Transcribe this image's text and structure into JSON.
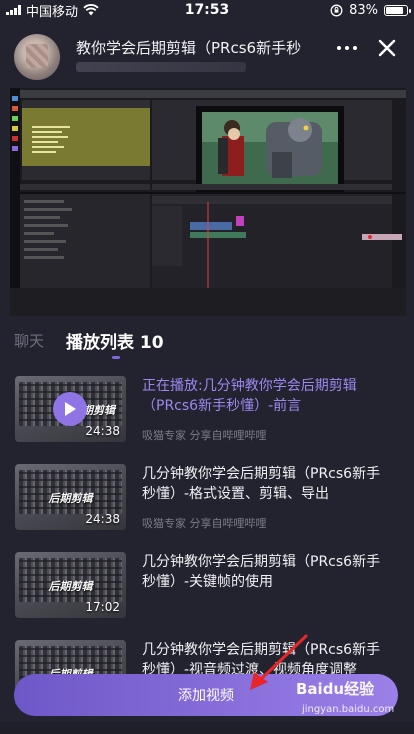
{
  "status_bar": {
    "carrier": "中国移动",
    "time": "17:53",
    "battery": "83%",
    "battery_level": 0.83
  },
  "header": {
    "title": "教你学会后期剪辑（PRcs6新手秒",
    "more_icon": "more-dots-icon",
    "close_icon": "close-icon"
  },
  "tabs": {
    "chat": "聊天",
    "playlist": "播放列表 10"
  },
  "playlist": [
    {
      "title": "正在播放:几分钟教你学会后期剪辑（PRcs6新手秒懂）-前言",
      "meta": "吸猫专家 分享自哔哩哔哩",
      "duration": "24:38",
      "playing": true,
      "thumb_label": "期剪辑"
    },
    {
      "title": "几分钟教你学会后期剪辑（PRcs6新手秒懂）-格式设置、剪辑、导出",
      "meta": "吸猫专家 分享自哔哩哔哩",
      "duration": "24:38",
      "playing": false,
      "thumb_label": "后期剪辑"
    },
    {
      "title": "几分钟教你学会后期剪辑（PRcs6新手秒懂）-关键帧的使用",
      "meta": "",
      "duration": "17:02",
      "playing": false,
      "thumb_label": "后期剪辑"
    },
    {
      "title": "几分钟教你学会后期剪辑（PRcs6新手秒懂）-视音频过渡、视频角度调整",
      "meta": "",
      "duration": "",
      "playing": false,
      "thumb_label": "后期剪辑"
    }
  ],
  "add_button": "添加视频",
  "watermark": {
    "text": "Baidu经验",
    "sub": "jingyan.baidu.com"
  },
  "colors": {
    "accent": "#8f74e6",
    "background": "#23232f",
    "current_title": "#9c87ee"
  }
}
